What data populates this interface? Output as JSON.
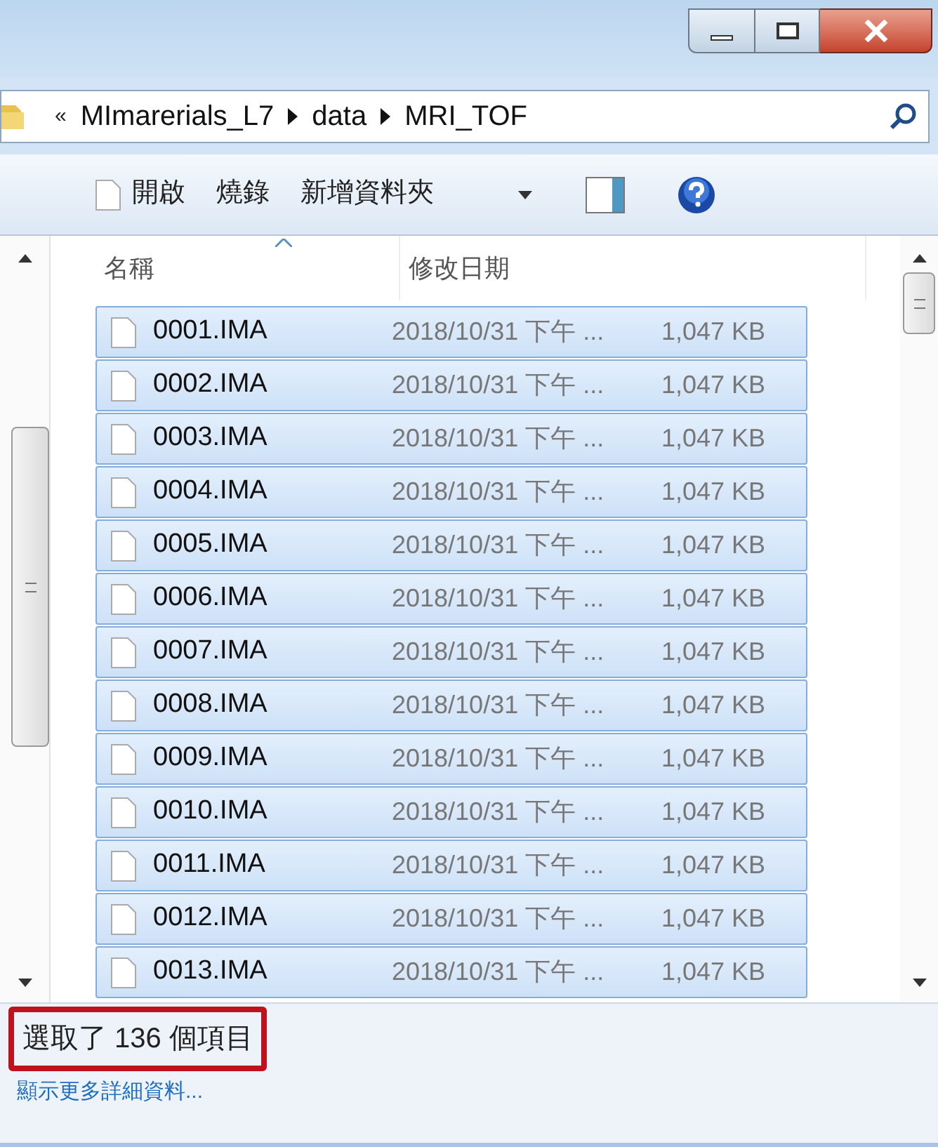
{
  "address": {
    "crumbs": [
      "MImarerials_L7",
      "data",
      "MRI_TOF"
    ],
    "overflow": "«"
  },
  "toolbar": {
    "items": [
      {
        "label": "開啟",
        "kind": "open"
      },
      {
        "label": "燒錄",
        "kind": "plain"
      },
      {
        "label": "新增資料夾",
        "kind": "plain"
      }
    ]
  },
  "columns": [
    "名稱",
    "修改日期"
  ],
  "rows": [
    {
      "name": "0001.IMA",
      "modified": "2018/10/31 下午 ...",
      "size": "1,047 KB",
      "selected": true
    },
    {
      "name": "0002.IMA",
      "modified": "2018/10/31 下午 ...",
      "size": "1,047 KB",
      "selected": true
    },
    {
      "name": "0003.IMA",
      "modified": "2018/10/31 下午 ...",
      "size": "1,047 KB",
      "selected": true
    },
    {
      "name": "0004.IMA",
      "modified": "2018/10/31 下午 ...",
      "size": "1,047 KB",
      "selected": true
    },
    {
      "name": "0005.IMA",
      "modified": "2018/10/31 下午 ...",
      "size": "1,047 KB",
      "selected": true
    },
    {
      "name": "0006.IMA",
      "modified": "2018/10/31 下午 ...",
      "size": "1,047 KB",
      "selected": true
    },
    {
      "name": "0007.IMA",
      "modified": "2018/10/31 下午 ...",
      "size": "1,047 KB",
      "selected": true
    },
    {
      "name": "0008.IMA",
      "modified": "2018/10/31 下午 ...",
      "size": "1,047 KB",
      "selected": true
    },
    {
      "name": "0009.IMA",
      "modified": "2018/10/31 下午 ...",
      "size": "1,047 KB",
      "selected": true
    },
    {
      "name": "0010.IMA",
      "modified": "2018/10/31 下午 ...",
      "size": "1,047 KB",
      "selected": true
    },
    {
      "name": "0011.IMA",
      "modified": "2018/10/31 下午 ...",
      "size": "1,047 KB",
      "selected": true
    },
    {
      "name": "0012.IMA",
      "modified": "2018/10/31 下午 ...",
      "size": "1,047 KB",
      "selected": true
    },
    {
      "name": "0013.IMA",
      "modified": "2018/10/31 下午 ...",
      "size": "1,047 KB",
      "selected": true
    }
  ],
  "status_bar": {
    "summary": "選取了 136 個項目",
    "highlighted": true,
    "link": "顯示更多詳細資料..."
  }
}
